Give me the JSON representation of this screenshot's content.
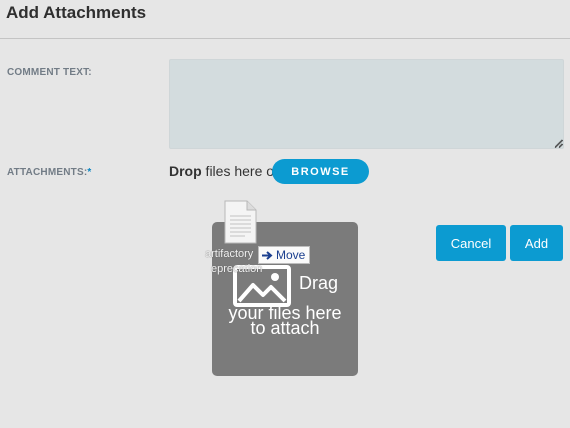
{
  "dialog": {
    "title": "Add Attachments"
  },
  "form": {
    "comment_label": "COMMENT TEXT:",
    "comment_value": "",
    "attachments_label": "ATTACHMENTS:",
    "required_marker": "*",
    "drop_bold": "Drop",
    "drop_rest": " files here or",
    "browse_label": "BROWSE"
  },
  "actions": {
    "cancel_label": "Cancel",
    "add_label": "Add"
  },
  "drag_overlay": {
    "line1": "Drag",
    "line2": "your files here",
    "line3": "to attach",
    "icon": "image-icon"
  },
  "dragged_file": {
    "name_line1": "artifactory",
    "name_line2": "eprecation",
    "icon": "document-icon",
    "drag_effect_label": "Move",
    "drag_effect_icon": "arrow-right-icon"
  },
  "colors": {
    "accent": "#0c9bd1",
    "background": "#e6e6e6",
    "textarea_bg": "#d3dcde",
    "overlay_bg": "#7b7b7b",
    "label_gray": "#727c86"
  }
}
